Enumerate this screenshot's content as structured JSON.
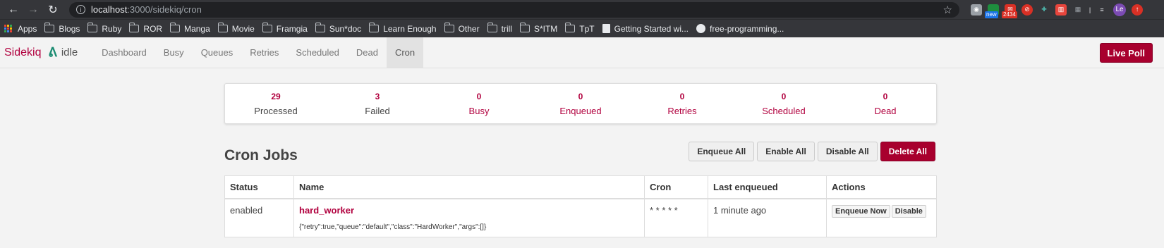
{
  "browser": {
    "url_host": "localhost",
    "url_path": ":3000/sidekiq/cron",
    "extension_badge_new": "new",
    "extension_badge_count": "2434",
    "profile_initials": "Le",
    "bookmarks": [
      "Apps",
      "Blogs",
      "Ruby",
      "ROR",
      "Manga",
      "Movie",
      "Framgia",
      "Sun*doc",
      "Learn Enough",
      "Other",
      "trill",
      "S*ITM",
      "TpT",
      "Getting Started wi...",
      "free-programming..."
    ]
  },
  "nav": {
    "brand": "Sidekiq",
    "status": "idle",
    "items": [
      "Dashboard",
      "Busy",
      "Queues",
      "Retries",
      "Scheduled",
      "Dead",
      "Cron"
    ],
    "live_poll": "Live Poll"
  },
  "summary": [
    {
      "value": "29",
      "label": "Processed"
    },
    {
      "value": "3",
      "label": "Failed"
    },
    {
      "value": "0",
      "label": "Busy"
    },
    {
      "value": "0",
      "label": "Enqueued"
    },
    {
      "value": "0",
      "label": "Retries"
    },
    {
      "value": "0",
      "label": "Scheduled"
    },
    {
      "value": "0",
      "label": "Dead"
    }
  ],
  "cron": {
    "title": "Cron Jobs",
    "buttons": {
      "enqueue_all": "Enqueue All",
      "enable_all": "Enable All",
      "disable_all": "Disable All",
      "delete_all": "Delete All"
    },
    "columns": [
      "Status",
      "Name",
      "Cron",
      "Last enqueued",
      "Actions"
    ],
    "rows": [
      {
        "status": "enabled",
        "name": "hard_worker",
        "args": "{\"retry\":true,\"queue\":\"default\",\"class\":\"HardWorker\",\"args\":[]}",
        "cron": "* * * * *",
        "last_enqueued": "1 minute ago",
        "enqueue_now": "Enqueue Now",
        "disable": "Disable"
      }
    ]
  },
  "colors": {
    "accent": "#b1003e",
    "button_danger": "#a8002e",
    "brand_icon": "#1b8c72"
  }
}
